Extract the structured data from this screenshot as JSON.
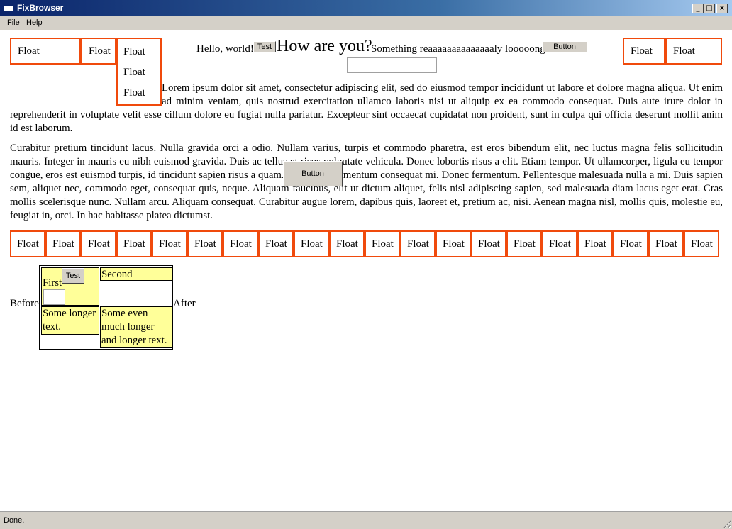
{
  "window": {
    "title": "FixBrowser",
    "buttons": {
      "minimize": "_",
      "maximize": "□",
      "close": "×"
    }
  },
  "menu": {
    "file": "File",
    "help": "Help"
  },
  "page": {
    "top_floats_left": [
      "Float",
      "Float"
    ],
    "vertical_floats": [
      "Float",
      "Float",
      "Float"
    ],
    "top_floats_right": [
      "Float",
      "Float"
    ],
    "hello_text": "Hello, world!",
    "test_button": "Test",
    "big_text": "How are you?",
    "long_text": "Something reaaaaaaaaaaaaaaly looooong",
    "button_label": "Button",
    "textbox_value": "",
    "paragraph1": "Lorem ipsum dolor sit amet, consectetur adipiscing elit, sed do eiusmod tempor incididunt ut labore et dolore magna aliqua. Ut enim ad minim veniam, quis nostrud exercitation ullamco laboris nisi ut aliquip ex ea commodo consequat. Duis aute irure dolor in reprehenderit in voluptate velit esse cillum dolore eu fugiat nulla pariatur. Excepteur sint occaecat cupidatat non proident, sunt in culpa qui officia deserunt mollit anim id est laborum.",
    "paragraph2": "Curabitur pretium tincidunt lacus. Nulla gravida orci a odio. Nullam varius, turpis et commodo pharetra, est eros bibendum elit, nec luctus magna felis sollicitudin mauris. Integer in mauris eu nibh euismod gravida. Duis ac tellus et risus vulputate vehicula. Donec lobortis risus a elit. Etiam tempor. Ut ullamcorper, ligula eu tempor congue, eros est euismod turpis, id tincidunt sapien risus a quam. Maecenas fermentum consequat mi. Donec fermentum. Pellentesque malesuada nulla a mi. Duis sapien sem, aliquet nec, commodo eget, consequat quis, neque. Aliquam faucibus, elit ut dictum aliquet, felis nisl adipiscing sapien, sed malesuada diam lacus eget erat. Cras mollis scelerisque nunc. Nullam arcu. Aliquam consequat. Curabitur augue lorem, dapibus quis, laoreet et, pretium ac, nisi. Aenean magna nisl, mollis quis, molestie eu, feugiat in, orci. In hac habitasse platea dictumst.",
    "overlay_button": "Button",
    "float_row": [
      "Float",
      "Float",
      "Float",
      "Float",
      "Float",
      "Float",
      "Float",
      "Float",
      "Float",
      "Float",
      "Float",
      "Float",
      "Float",
      "Float",
      "Float",
      "Float",
      "Float",
      "Float",
      "Float",
      "Float"
    ],
    "before_text": "Before",
    "after_text": "After",
    "table": {
      "first": "First",
      "test_button": "Test",
      "second": "Second",
      "cell3": "Some longer text.",
      "cell4": "Some even much longer and longer text."
    }
  },
  "status": {
    "text": "Done."
  },
  "colors": {
    "float_border": "#f04a0c",
    "cell_bg": "#ffff99",
    "titlebar": "#0a246a"
  }
}
